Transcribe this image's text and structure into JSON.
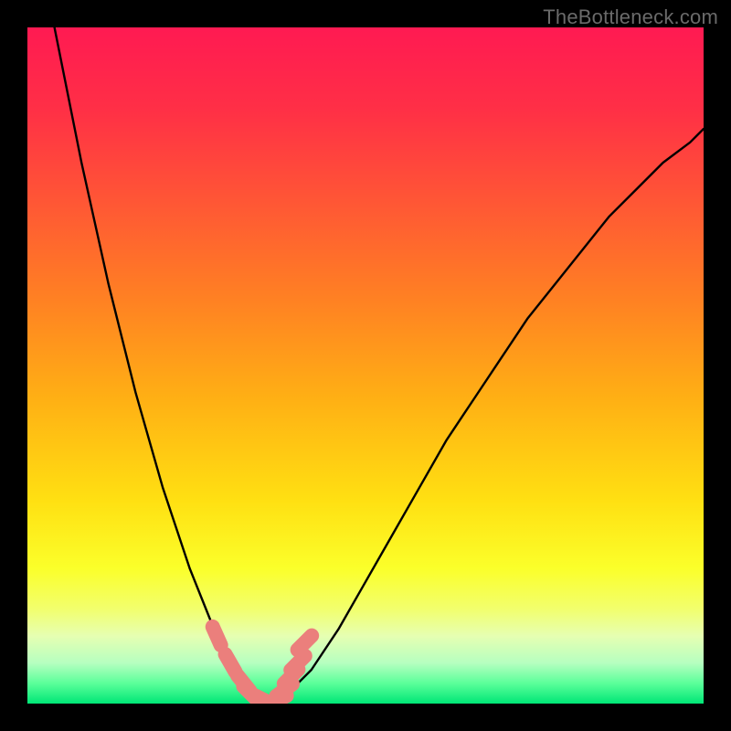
{
  "watermark": "TheBottleneck.com",
  "chart_data": {
    "type": "line",
    "title": "",
    "xlabel": "",
    "ylabel": "",
    "xlim": [
      0,
      100
    ],
    "ylim": [
      0,
      100
    ],
    "grid": false,
    "legend": false,
    "series": [
      {
        "name": "bottleneck-curve",
        "x": [
          4,
          6,
          8,
          10,
          12,
          14,
          16,
          18,
          20,
          22,
          24,
          26,
          28,
          30,
          32,
          34,
          36,
          38,
          42,
          46,
          50,
          54,
          58,
          62,
          66,
          70,
          74,
          78,
          82,
          86,
          90,
          94,
          98,
          100
        ],
        "y": [
          100,
          90,
          80,
          71,
          62,
          54,
          46,
          39,
          32,
          26,
          20,
          15,
          10,
          6,
          3,
          1,
          0,
          1,
          5,
          11,
          18,
          25,
          32,
          39,
          45,
          51,
          57,
          62,
          67,
          72,
          76,
          80,
          83,
          85
        ]
      }
    ],
    "markers": {
      "name": "highlight-points",
      "color": "#eb7f7c",
      "points": [
        {
          "x": 28,
          "y": 10
        },
        {
          "x": 30,
          "y": 6
        },
        {
          "x": 32,
          "y": 3
        },
        {
          "x": 33,
          "y": 1.5
        },
        {
          "x": 35,
          "y": 0.5
        },
        {
          "x": 37,
          "y": 0.5
        },
        {
          "x": 38,
          "y": 2
        },
        {
          "x": 39,
          "y": 4
        },
        {
          "x": 40,
          "y": 6
        },
        {
          "x": 41,
          "y": 9
        }
      ]
    },
    "background_gradient": {
      "stops": [
        {
          "pos": 0.0,
          "color": "#ff1a52"
        },
        {
          "pos": 0.12,
          "color": "#ff2f46"
        },
        {
          "pos": 0.25,
          "color": "#ff5436"
        },
        {
          "pos": 0.4,
          "color": "#ff8023"
        },
        {
          "pos": 0.55,
          "color": "#ffb014"
        },
        {
          "pos": 0.7,
          "color": "#ffe012"
        },
        {
          "pos": 0.8,
          "color": "#fbff2a"
        },
        {
          "pos": 0.86,
          "color": "#f2ff6d"
        },
        {
          "pos": 0.9,
          "color": "#e6ffb2"
        },
        {
          "pos": 0.94,
          "color": "#b6ffc0"
        },
        {
          "pos": 0.97,
          "color": "#5bff9a"
        },
        {
          "pos": 1.0,
          "color": "#00e676"
        }
      ]
    }
  }
}
